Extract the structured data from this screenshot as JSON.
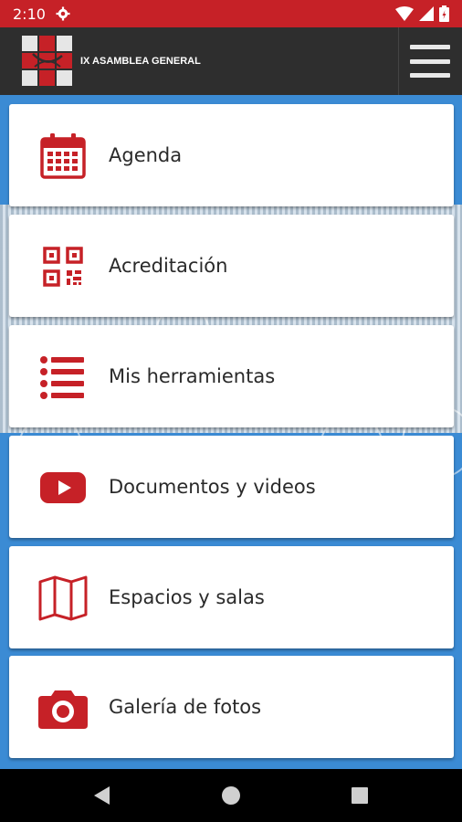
{
  "status_bar": {
    "time": "2:10",
    "background": "#c62127"
  },
  "app_bar": {
    "title": "IX ASAMBLEA GENERAL",
    "background": "#2e2e2e"
  },
  "menu": {
    "accent": "#c62127",
    "items": [
      {
        "label": "Agenda",
        "icon": "calendar-icon"
      },
      {
        "label": "Acreditación",
        "icon": "qr-code-icon"
      },
      {
        "label": "Mis herramientas",
        "icon": "list-icon"
      },
      {
        "label": "Documentos y videos",
        "icon": "youtube-play-icon"
      },
      {
        "label": "Espacios y salas",
        "icon": "map-icon"
      },
      {
        "label": "Galería de fotos",
        "icon": "camera-icon"
      }
    ]
  },
  "content_background": "#3b8bd4"
}
